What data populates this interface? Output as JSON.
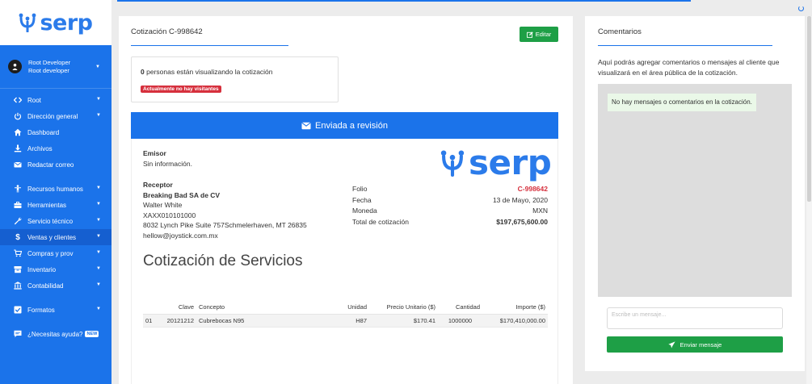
{
  "brand": {
    "name": "serp",
    "primary_color": "#1b73ea",
    "success_color": "#1e9f46",
    "danger_color": "#d6303d"
  },
  "sidebar": {
    "user": {
      "name": "Root Developer",
      "role": "Root developer"
    },
    "items": [
      {
        "label": "Root",
        "icon": "code-icon",
        "chevron": true
      },
      {
        "label": "Dirección general",
        "icon": "power-icon",
        "chevron": true
      },
      {
        "label": "Dashboard",
        "icon": "home-icon",
        "chevron": false
      },
      {
        "label": "Archivos",
        "icon": "download-icon",
        "chevron": false
      },
      {
        "label": "Redactar correo",
        "icon": "envelope-icon",
        "chevron": false
      },
      {
        "label": "Recursos humanos",
        "icon": "person-icon",
        "chevron": true
      },
      {
        "label": "Herramientas",
        "icon": "toolbox-icon",
        "chevron": true
      },
      {
        "label": "Servicio técnico",
        "icon": "wrench-icon",
        "chevron": true
      },
      {
        "label": "Ventas y clientes",
        "icon": "dollar-icon",
        "chevron": true,
        "active": true
      },
      {
        "label": "Compras y prov",
        "icon": "cart-icon",
        "chevron": true
      },
      {
        "label": "Inventario",
        "icon": "inventory-icon",
        "chevron": true
      },
      {
        "label": "Contabilidad",
        "icon": "bank-icon",
        "chevron": true
      },
      {
        "label": "Formatos",
        "icon": "checkbox-icon",
        "chevron": true
      },
      {
        "label": "¿Necesitas ayuda?",
        "icon": "chat-icon",
        "chevron": false,
        "badge": "NEW"
      }
    ]
  },
  "main": {
    "title": "Cotización C-998642",
    "edit_label": "Editar",
    "viewers": {
      "count": "0",
      "text": "personas están visualizando la cotización",
      "badge": "Actualmente no hay visitantes"
    },
    "status": "Enviada a revisión",
    "emisor": {
      "label": "Emisor",
      "value": "Sin información."
    },
    "receptor": {
      "label": "Receptor",
      "company": "Breaking Bad SA de CV",
      "contact": "Walter White",
      "rfc": "XAXX010101000",
      "address": "8032 Lynch Pike Suite 757Schmelerhaven, MT 26835",
      "email": "hellow@joystick.com.mx"
    },
    "meta": [
      {
        "label": "Folio",
        "value": "C-998642",
        "style": "red"
      },
      {
        "label": "Fecha",
        "value": "13 de Mayo, 2020",
        "style": ""
      },
      {
        "label": "Moneda",
        "value": "MXN",
        "style": ""
      },
      {
        "label": "Total de cotización",
        "value": "$197,675,600.00",
        "style": "bold"
      }
    ],
    "heading": "Cotización de Servicios",
    "table": {
      "headers": [
        "",
        "Clave",
        "Concepto",
        "Unidad",
        "Precio Unitario ($)",
        "Cantidad",
        "Importe ($)"
      ],
      "rows": [
        [
          "01",
          "20121212",
          "Cubrebocas N95",
          "H87",
          "$170.41",
          "1000000",
          "$170,410,000.00"
        ]
      ]
    }
  },
  "comments": {
    "title": "Comentarios",
    "intro": "Aquí podrás agregar comentarios o mensajes al cliente que visualizará en el área pública de la cotización.",
    "empty_message": "No hay mensajes o comentarios en la cotización.",
    "input_placeholder": "Escribe un mensaje...",
    "send_label": "Enviar mensaje"
  }
}
